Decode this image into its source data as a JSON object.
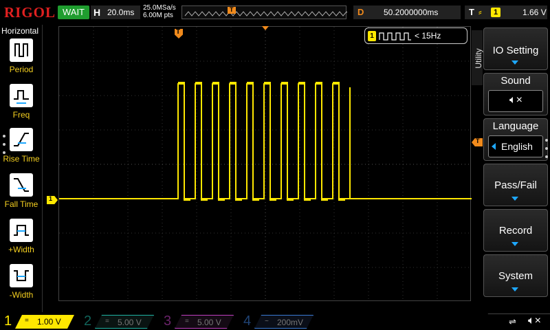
{
  "brand": "RIGOL",
  "status": "WAIT",
  "horizontal": {
    "label": "H",
    "timebase": "20.0ms"
  },
  "acquisition": {
    "sample_rate": "25.0MSa/s",
    "memory_depth": "6.00M pts"
  },
  "trigger_marker": "T",
  "delay": {
    "label": "D",
    "value": "50.2000000ms"
  },
  "trigger": {
    "label": "T",
    "slope_icon": "rising-edge-icon",
    "source": "1",
    "level": "1.66 V"
  },
  "left_menu": {
    "title": "Horizontal",
    "items": [
      {
        "label": "Period",
        "icon": "period-measure-icon"
      },
      {
        "label": "Freq",
        "icon": "frequency-measure-icon"
      },
      {
        "label": "Rise Time",
        "icon": "rise-time-icon"
      },
      {
        "label": "Fall Time",
        "icon": "fall-time-icon"
      },
      {
        "label": "+Width",
        "icon": "positive-width-icon"
      },
      {
        "label": "-Width",
        "icon": "negative-width-icon"
      }
    ]
  },
  "counter": {
    "channel": "1",
    "value": "< 15Hz"
  },
  "channel_marker": "1",
  "right_menu": {
    "tab_label": "Utility",
    "items": [
      {
        "label": "IO Setting"
      },
      {
        "label": "Sound",
        "value_icon": "speaker-mute-icon"
      },
      {
        "label": "Language",
        "value": "English"
      },
      {
        "label": "Pass/Fail"
      },
      {
        "label": "Record"
      },
      {
        "label": "System"
      }
    ]
  },
  "channels": [
    {
      "num": "1",
      "coupling": "=",
      "scale": "1.00 V",
      "color": "#ffe800",
      "active": true
    },
    {
      "num": "2",
      "coupling": "=",
      "scale": "5.00 V",
      "color": "#1fb5a5",
      "active": false
    },
    {
      "num": "3",
      "coupling": "=",
      "scale": "5.00 V",
      "color": "#c040c0",
      "active": false
    },
    {
      "num": "4",
      "coupling": "~",
      "scale": "200mV",
      "color": "#3a7bd5",
      "active": false
    }
  ],
  "colors": {
    "ch1": "#ffe800",
    "trigger": "#f08a1c",
    "accent": "#1ea8ff"
  }
}
